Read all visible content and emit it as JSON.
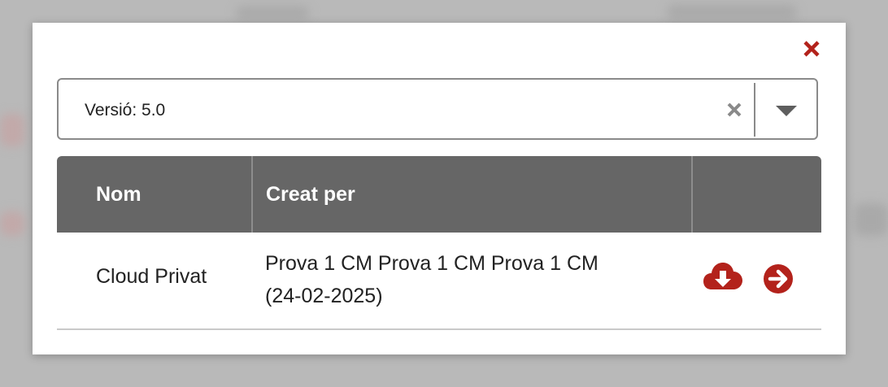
{
  "modal": {
    "version_select": {
      "value": "Versió: 5.0"
    },
    "table": {
      "headers": {
        "name": "Nom",
        "created_by": "Creat per",
        "actions": ""
      },
      "rows": [
        {
          "name": "Cloud Privat",
          "created_by_line1": "Prova 1 CM Prova 1 CM Prova 1 CM",
          "created_by_line2": "(24-02-2025)"
        }
      ]
    },
    "icons": {
      "close": "close-icon",
      "clear": "clear-icon",
      "dropdown": "caret-down-icon",
      "download": "cloud-download-icon",
      "open": "arrow-circle-right-icon"
    },
    "colors": {
      "accent": "#b3221b",
      "header_bg": "#666666"
    }
  }
}
